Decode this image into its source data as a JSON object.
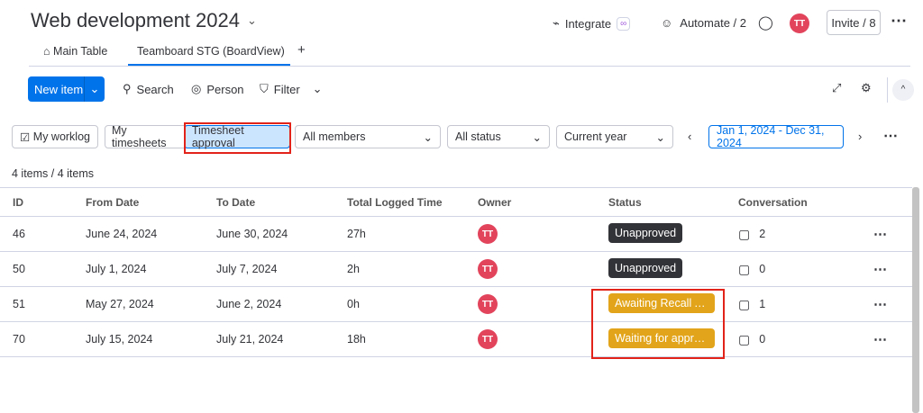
{
  "header": {
    "title": "Web development 2024",
    "integrate": "Integrate",
    "automate": "Automate / 2",
    "avatar": "TT",
    "invite": "Invite / 8"
  },
  "tabs": [
    {
      "label": "Main Table"
    },
    {
      "label": "Teamboard STG (BoardView)"
    },
    {
      "label": "+"
    }
  ],
  "toolbar": {
    "new_item": "New item",
    "search": "Search",
    "person": "Person",
    "filter": "Filter"
  },
  "filters": {
    "my_worklog": "My worklog",
    "my_timesheets": "My timesheets",
    "timesheet_approval": "Timesheet approval",
    "members": "All members",
    "status": "All status",
    "period": "Current year",
    "date_range": "Jan 1, 2024 - Dec 31, 2024"
  },
  "count": "4 items / 4 items",
  "table": {
    "columns": [
      "ID",
      "From Date",
      "To Date",
      "Total Logged Time",
      "Owner",
      "Status",
      "Conversation"
    ],
    "rows": [
      {
        "id": "46",
        "from": "June 24, 2024",
        "to": "June 30, 2024",
        "time": "27h",
        "owner": "TT",
        "status": "Unapproved",
        "status_color": "#323338",
        "conv": "2"
      },
      {
        "id": "50",
        "from": "July 1, 2024",
        "to": "July 7, 2024",
        "time": "2h",
        "owner": "TT",
        "status": "Unapproved",
        "status_color": "#323338",
        "conv": "0"
      },
      {
        "id": "51",
        "from": "May 27, 2024",
        "to": "June 2, 2024",
        "time": "0h",
        "owner": "TT",
        "status": "Awaiting Recall Approval",
        "status_color": "#e2a41a",
        "conv": "1"
      },
      {
        "id": "70",
        "from": "July 15, 2024",
        "to": "July 21, 2024",
        "time": "18h",
        "owner": "TT",
        "status": "Waiting for approval",
        "status_color": "#e2a41a",
        "conv": "0"
      }
    ]
  }
}
